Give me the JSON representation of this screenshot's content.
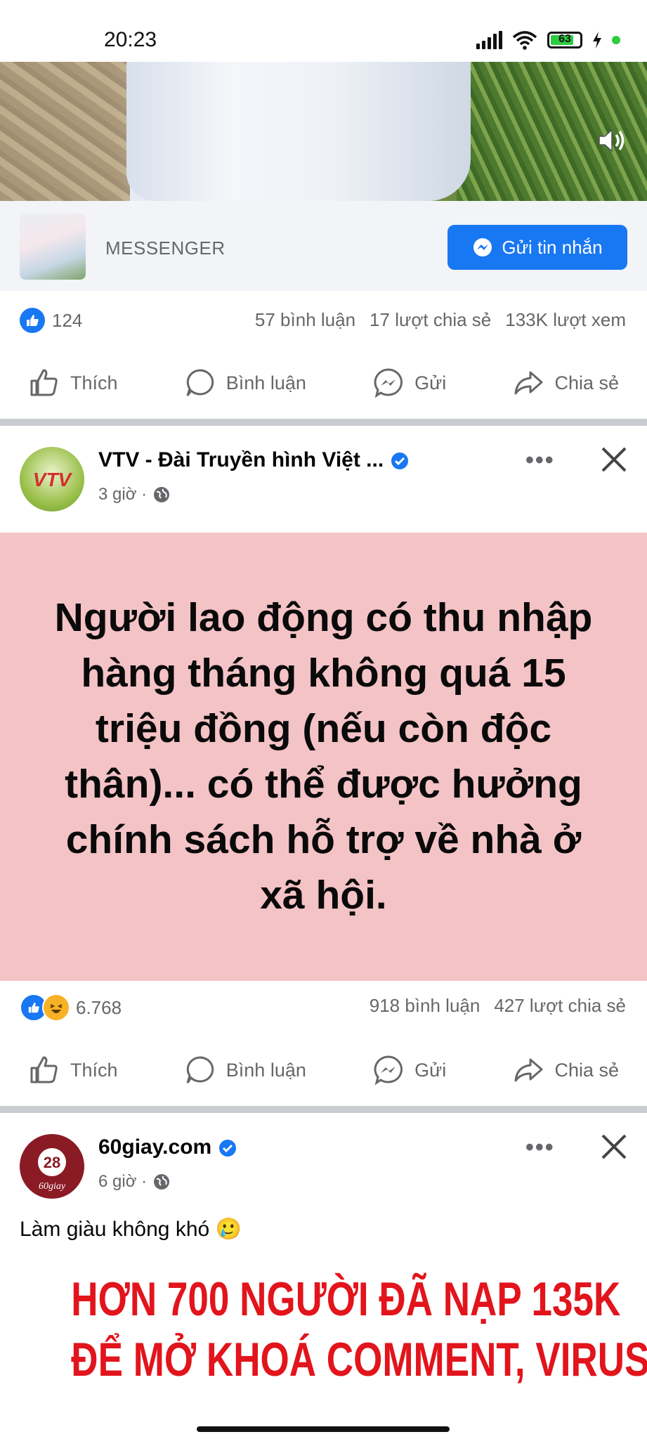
{
  "status_bar": {
    "time": "20:23",
    "battery": "63",
    "icons": [
      "signal-icon",
      "wifi-icon",
      "battery-icon",
      "charging-icon"
    ]
  },
  "video": {
    "icons": [
      "speaker-icon"
    ]
  },
  "messenger_bar": {
    "label": "MESSENGER",
    "button_label": "Gửi tin nhắn"
  },
  "post1_stats": {
    "likes": "124",
    "comments": "57 bình luận",
    "shares": "17 lượt chia sẻ",
    "views": "133K lượt xem"
  },
  "actions": {
    "like": "Thích",
    "comment": "Bình luận",
    "send": "Gửi",
    "share": "Chia sẻ"
  },
  "post2": {
    "author": "VTV - Đài Truyền hình Việt ...",
    "time": "3 giờ ·",
    "card_text": "Người lao động có thu nhập hàng tháng không quá 15 triệu đồng (nếu còn độc thân)... có thể được hưởng chính sách hỗ trợ về nhà ở xã hội.",
    "reactions": "6.768",
    "comments": "918 bình luận",
    "shares": "427 lượt chia sẻ"
  },
  "post3": {
    "author": "60giay.com",
    "time": "6 giờ ·",
    "caption": "Làm giàu không khó 🥲",
    "promo_line1": "HƠN 700 NGƯỜI ĐÃ NẠP 135K",
    "promo_line2": "ĐỂ MỞ KHOÁ COMMENT, VIRUSS KIẾM"
  },
  "colors": {
    "facebook_blue": "#1877f2",
    "card_pink": "#f4c3c6",
    "promo_red": "#e2141c",
    "muted_text": "#65676b"
  }
}
